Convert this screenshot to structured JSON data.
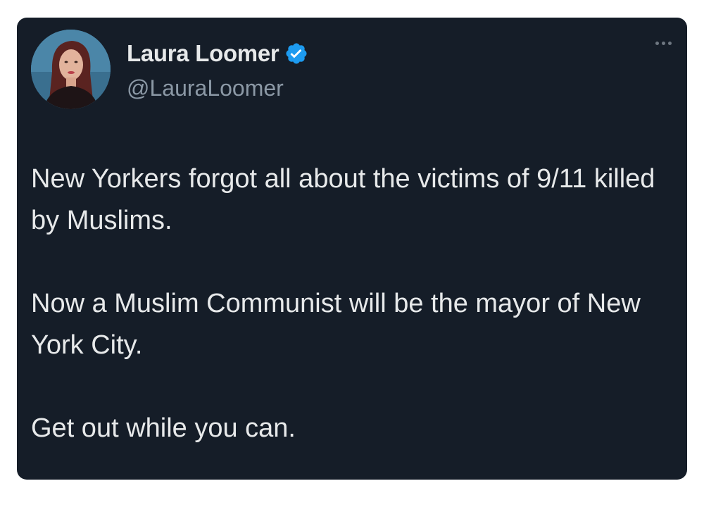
{
  "tweet": {
    "author_name": "Laura Loomer",
    "author_handle": "@LauraLoomer",
    "verified": true,
    "verified_badge_color": "#1d9bf0",
    "more_icon": "ellipsis-horizontal",
    "paragraphs": [
      "New Yorkers forgot all about the victims of 9/11 killed by Muslims.",
      "Now a Muslim Communist will be the mayor of New York City.",
      "Get out while you can."
    ]
  },
  "colors": {
    "card_background": "#151d28",
    "primary_text": "#e7e9ea",
    "secondary_text": "#8b98a5"
  }
}
